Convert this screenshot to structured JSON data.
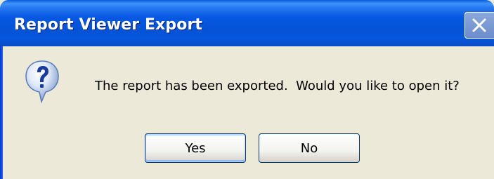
{
  "dialog": {
    "title": "Report Viewer Export",
    "icon": "question-icon",
    "message": "The report has been exported.  Would you like to open it?"
  },
  "buttons": {
    "yes_label": "Yes",
    "no_label": "No"
  },
  "titlebar": {
    "close_icon": "close-icon"
  },
  "colors": {
    "titlebar_blue": "#0453d6",
    "dialog_face": "#ece9d8",
    "button_border": "#003c74"
  }
}
